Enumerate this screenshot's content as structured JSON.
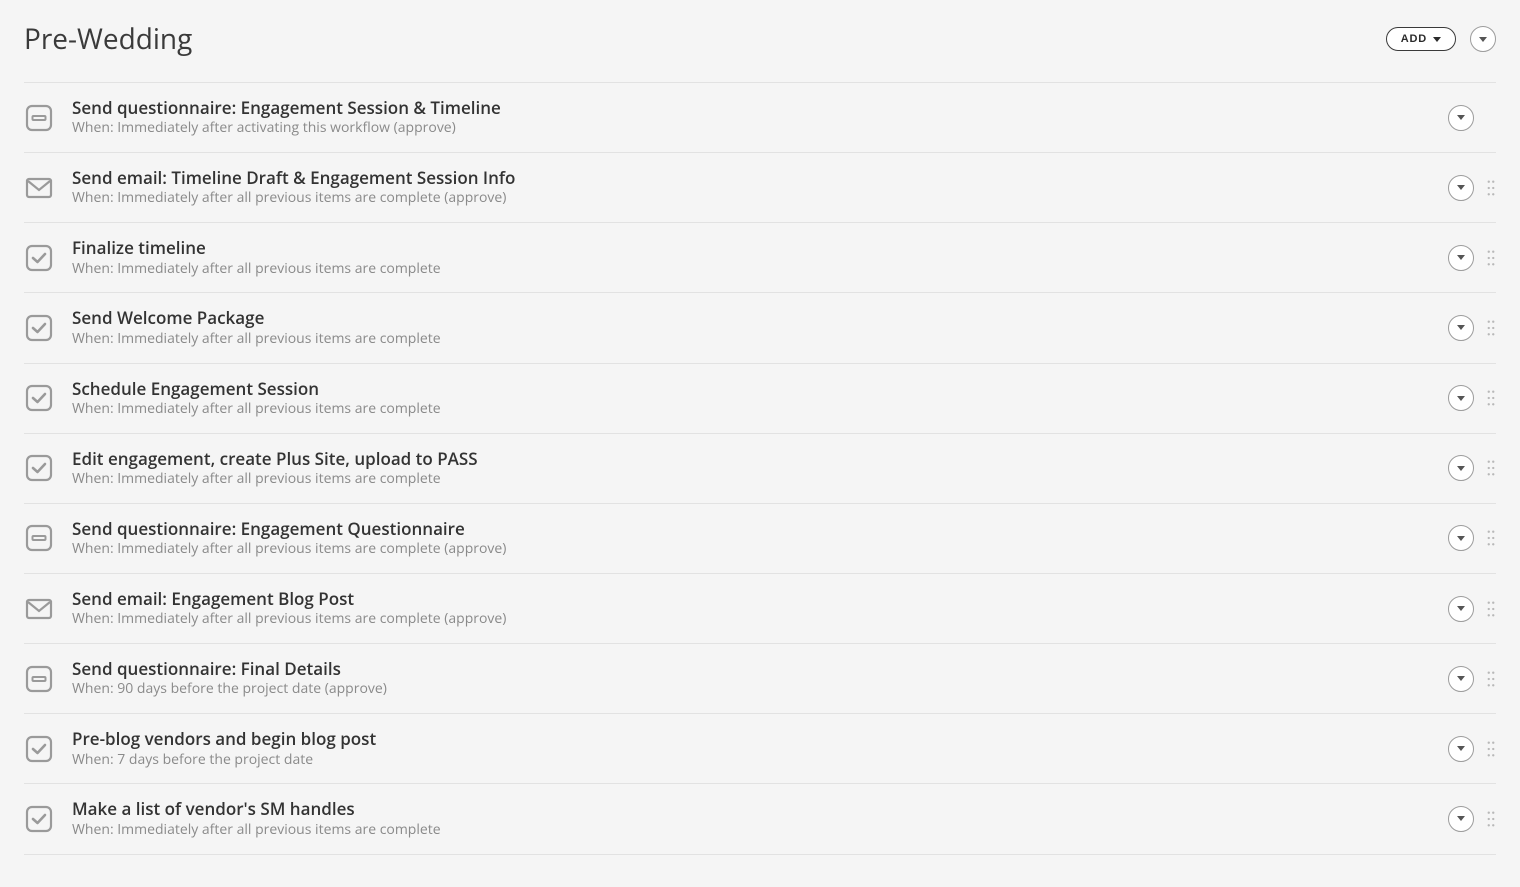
{
  "section": {
    "title": "Pre-Wedding",
    "add_label": "ADD"
  },
  "items": [
    {
      "icon": "questionnaire",
      "title": "Send questionnaire: Engagement Session & Timeline",
      "when": "When: Immediately after activating this workflow (approve)",
      "drag": false
    },
    {
      "icon": "email",
      "title": "Send email: Timeline Draft & Engagement Session Info",
      "when": "When: Immediately after all previous items are complete (approve)",
      "drag": true
    },
    {
      "icon": "todo",
      "title": "Finalize timeline",
      "when": "When: Immediately after all previous items are complete",
      "drag": true
    },
    {
      "icon": "todo",
      "title": "Send Welcome Package",
      "when": "When: Immediately after all previous items are complete",
      "drag": true
    },
    {
      "icon": "todo",
      "title": "Schedule Engagement Session",
      "when": "When: Immediately after all previous items are complete",
      "drag": true
    },
    {
      "icon": "todo",
      "title": "Edit engagement, create Plus Site, upload to PASS",
      "when": "When: Immediately after all previous items are complete",
      "drag": true
    },
    {
      "icon": "questionnaire",
      "title": "Send questionnaire: Engagement Questionnaire",
      "when": "When: Immediately after all previous items are complete (approve)",
      "drag": true
    },
    {
      "icon": "email",
      "title": "Send email: Engagement Blog Post",
      "when": "When: Immediately after all previous items are complete (approve)",
      "drag": true
    },
    {
      "icon": "questionnaire",
      "title": "Send questionnaire: Final Details",
      "when": "When: 90 days before the project date (approve)",
      "drag": true
    },
    {
      "icon": "todo",
      "title": "Pre-blog vendors and begin blog post",
      "when": "When: 7 days before the project date",
      "drag": true
    },
    {
      "icon": "todo",
      "title": "Make a list of vendor's SM handles",
      "when": "When: Immediately after all previous items are complete",
      "drag": true
    }
  ]
}
